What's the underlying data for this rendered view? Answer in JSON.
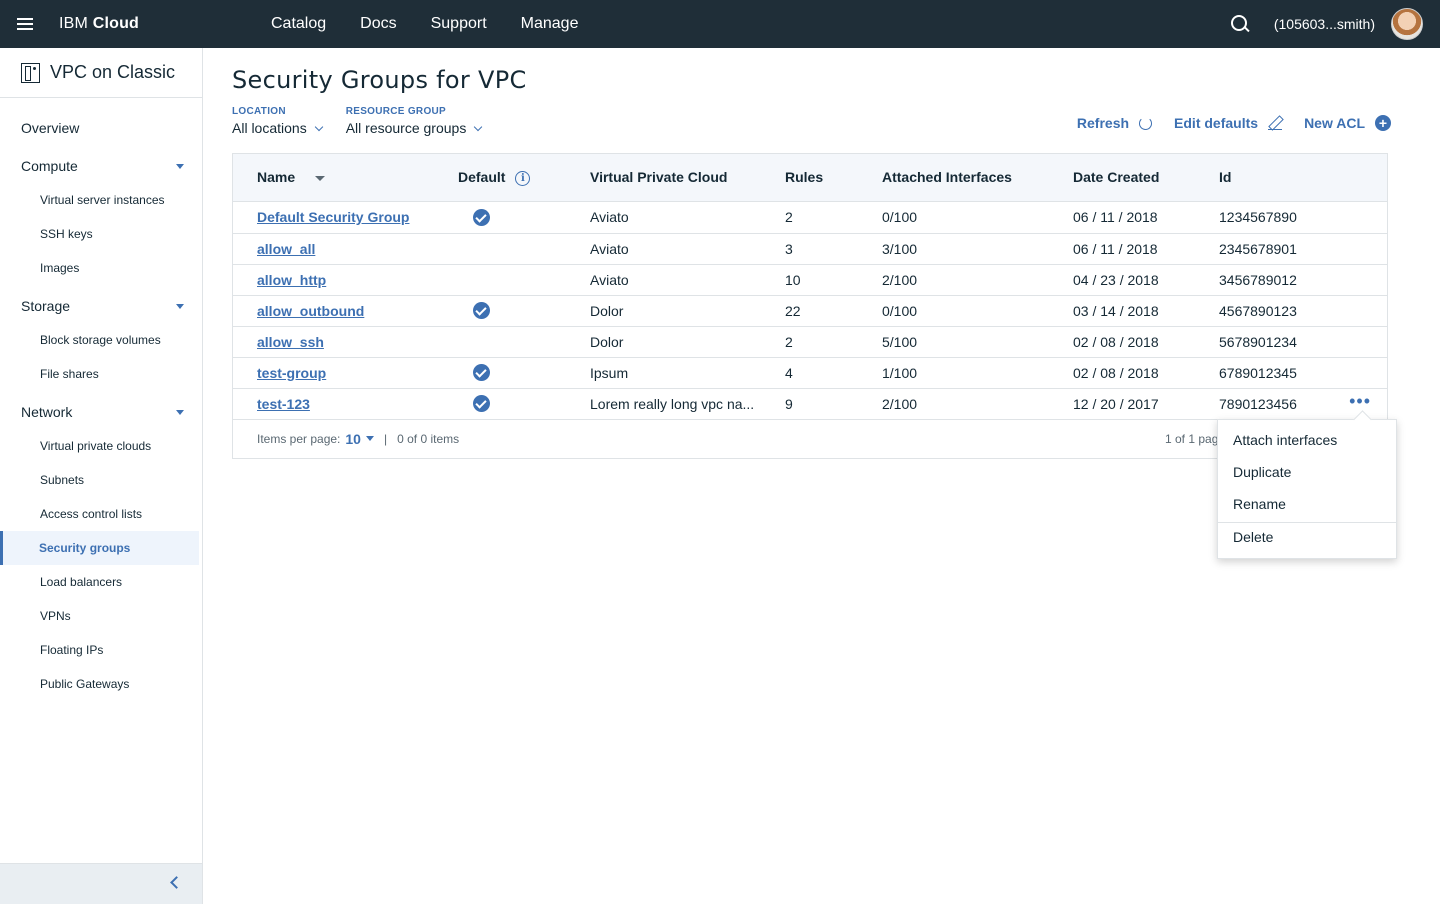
{
  "topbar": {
    "brand_light": "IBM ",
    "brand_bold": "Cloud",
    "nav": [
      "Catalog",
      "Docs",
      "Support",
      "Manage"
    ],
    "account": "(105603...smith)"
  },
  "sidebar": {
    "title": "VPC on Classic",
    "overview": "Overview",
    "groups": [
      {
        "label": "Compute",
        "items": [
          "Virtual server instances",
          "SSH keys",
          "Images"
        ]
      },
      {
        "label": "Storage",
        "items": [
          "Block storage volumes",
          "File shares"
        ]
      },
      {
        "label": "Network",
        "items": [
          "Virtual private clouds",
          "Subnets",
          "Access control lists",
          "Security groups",
          "Load balancers",
          "VPNs",
          "Floating IPs",
          "Public Gateways"
        ]
      }
    ],
    "active_item": "Security groups"
  },
  "page": {
    "title": "Security Groups for VPC",
    "filters": {
      "location_label": "LOCATION",
      "location_value": "All locations",
      "group_label": "RESOURCE GROUP",
      "group_value": "All resource groups"
    },
    "actions": {
      "refresh": "Refresh",
      "edit_defaults": "Edit defaults",
      "new_acl": "New ACL"
    }
  },
  "table": {
    "columns": [
      "Name",
      "Default",
      "Virtual Private Cloud",
      "Rules",
      "Attached Interfaces",
      "Date Created",
      "Id"
    ],
    "rows": [
      {
        "name": "Default Security Group",
        "default": true,
        "vpc": "Aviato",
        "rules": "2",
        "attached": "0/100",
        "date": "06 / 11 / 2018",
        "id": "1234567890"
      },
      {
        "name": "allow_all",
        "default": false,
        "vpc": "Aviato",
        "rules": "3",
        "attached": "3/100",
        "date": "06 / 11 / 2018",
        "id": "2345678901"
      },
      {
        "name": "allow_http",
        "default": false,
        "vpc": "Aviato",
        "rules": "10",
        "attached": "2/100",
        "date": "04 / 23 / 2018",
        "id": "3456789012"
      },
      {
        "name": "allow_outbound",
        "default": true,
        "vpc": "Dolor",
        "rules": "22",
        "attached": "0/100",
        "date": "03 / 14 / 2018",
        "id": "4567890123"
      },
      {
        "name": "allow_ssh",
        "default": false,
        "vpc": "Dolor",
        "rules": "2",
        "attached": "5/100",
        "date": "02 / 08 / 2018",
        "id": "5678901234"
      },
      {
        "name": "test-group",
        "default": true,
        "vpc": "Ipsum",
        "rules": "4",
        "attached": "1/100",
        "date": "02 / 08 / 2018",
        "id": "6789012345"
      },
      {
        "name": "test-123",
        "default": true,
        "vpc": "Lorem really long vpc na...",
        "rules": "9",
        "attached": "2/100",
        "date": "12 / 20 / 2017",
        "id": "7890123456"
      }
    ],
    "pager": {
      "per_page_label": "Items per page:",
      "per_page_value": "10",
      "separator": "|",
      "items_info": "0 of 0 items",
      "page_info": "1 of 1 pag"
    }
  },
  "overflow_menu": {
    "items": [
      "Attach interfaces",
      "Duplicate",
      "Rename",
      "Delete"
    ]
  }
}
